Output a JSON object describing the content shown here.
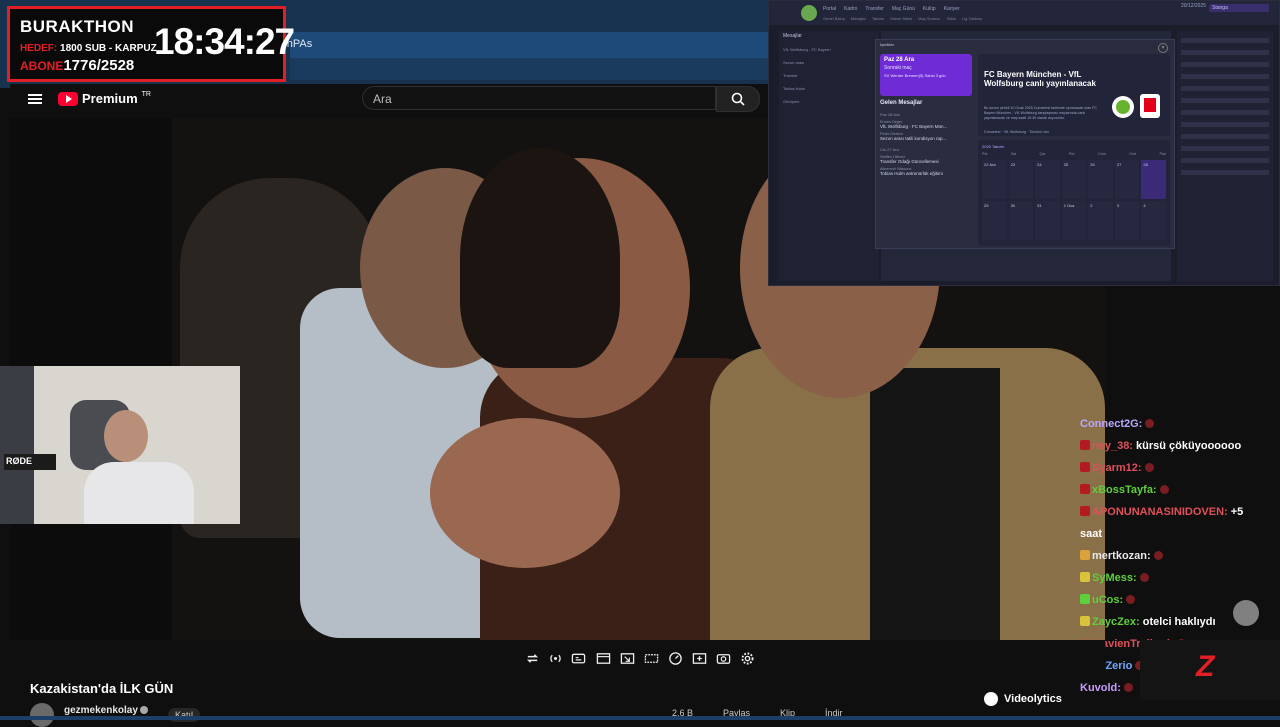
{
  "browser": {
    "tab_text": "FhPAs"
  },
  "counter": {
    "title": "BURAKTHON",
    "hedef_label": "HEDEF:",
    "hedef_value": "1800 SUB - KARPUZ",
    "abone_label": "ABONE",
    "abone_value": "1776/2528",
    "clock": "18:34:27"
  },
  "youtube": {
    "logo_text": "Premium",
    "logo_region": "TR",
    "search_placeholder": "Ara",
    "video_title": "Kazakistan'da İLK GÜN",
    "channel_name": "gezmekenkolay",
    "join_label": "Katıl",
    "actions": [
      "2,6 B",
      "Paylaş",
      "Klip",
      "İndir"
    ]
  },
  "webcam": {
    "mic_label": "RØDE"
  },
  "dashboard": {
    "nav": [
      "Portal",
      "Kadro",
      "Transfer",
      "Maç Günü",
      "Kulüp",
      "Kariyer"
    ],
    "subnav": [
      "Genel Bakış",
      "Mesajlar",
      "Takvim",
      "Haber Sitesi",
      "Maç Sonucu",
      "Tablo",
      "Lig Tablosu"
    ],
    "date_text": "20/12/2025",
    "lang_label": "Stanga",
    "left_panel_title": "Mesajlar",
    "left_rows": [
      "VfL Wolfsburg - FC Bayern",
      "Sezon arası",
      "Transfer",
      "Tobias Holm",
      "Görüşme"
    ],
    "modal_header": "İçerikler",
    "next_match": {
      "date": "Paz 28 Ara",
      "label": "Sonraki maç",
      "detail": "SV Werder Bremen(5) Sahsi 3 gün"
    },
    "messages_title": "Gelen Mesajlar",
    "message_groups": [
      {
        "section": "Paz 28 Ara",
        "items": [
          {
            "title": "VfL Wolfsburg - FC Bayern Mün...",
            "from": "Ermes Degre"
          },
          {
            "title": "Sezon arası tatili kondisyon rap...",
            "from": "Peter Dietrich"
          }
        ]
      },
      {
        "section": "Cts 27 Ara",
        "items": [
          {
            "title": "Transfer Odağı Güncellemesi",
            "from": "Steffen Hilbner"
          },
          {
            "title": "Tobias Holm antrenörlük eğitimi",
            "from": "Akberrcel Nilssons"
          }
        ]
      }
    ],
    "article": {
      "title": "FC Bayern München - VfL Wolfsburg canlı yayınlanacak",
      "body": "Bu sezon şehirli 10 Ocak 2025 Cumartesi tarihinde oynanacak olan FC Bayern München - VfL Wolfsburg karşılaşması maçlarında canlı yayınlanacak ve maç saati 15:30 olarak duyuruldu.",
      "meta": "Cumartesi · VfL Wolfsburg · Tümünü oku"
    },
    "calendar": {
      "header": "2025 Takvim",
      "days": [
        "Pzt",
        "Sal",
        "Çar",
        "Per",
        "Cum",
        "Cmt",
        "Paz"
      ],
      "cells": [
        "22 Ara",
        "23",
        "24",
        "25",
        "26",
        "27",
        "28",
        "29",
        "30",
        "31",
        "1 Oca",
        "2",
        "3",
        "4"
      ]
    }
  },
  "chat": [
    {
      "user": "Connect2G:",
      "message": "",
      "color": "#b9a9ff",
      "badge": ""
    },
    {
      "user": "ney_38:",
      "message": "kürsü çöküyoooooo",
      "color": "#e0505a",
      "badge": "#b31a22"
    },
    {
      "user": "Syarm12:",
      "message": "",
      "color": "#e0505a",
      "badge": "#b31a22"
    },
    {
      "user": "xBossTayfa:",
      "message": "",
      "color": "#5fcf3b",
      "badge": "#b31a22"
    },
    {
      "user": "APONUNANASINIDOVEN:",
      "message": "+5",
      "color": "#e0505a",
      "badge": "#b31a22"
    },
    {
      "user": "",
      "message": "saat",
      "color": "#ffffff",
      "badge": ""
    },
    {
      "user": "mertkozan:",
      "message": "",
      "color": "#e8e8e8",
      "badge": "#d9a23a"
    },
    {
      "user": "SyMess:",
      "message": "",
      "color": "#5fcf3b",
      "badge": "#d9c33a"
    },
    {
      "user": "uCos:",
      "message": "",
      "color": "#5fcf3b",
      "badge": "#5fcf3b"
    },
    {
      "user": "ZaycZex:",
      "message": "otelci haklıydı",
      "color": "#5fcf3b",
      "badge": "#d9c33a"
    },
    {
      "user": "SirSavienTrallard:",
      "message": "",
      "color": "#e0505a",
      "badge": ""
    },
    {
      "user": "MrZerio",
      "message": "",
      "color": "#6fa8ff",
      "badge": "#d9c33a"
    },
    {
      "user": "Kuvold:",
      "message": "",
      "color": "#c79bff",
      "badge": ""
    }
  ],
  "overlay": {
    "videolytics_label": "Videolytics",
    "brand_letter": "Z"
  },
  "icons": [
    "menu-icon",
    "search-icon",
    "loop-icon",
    "live-icon",
    "cc-icon",
    "chapters-icon",
    "miniplayer-icon",
    "theater-icon",
    "speed-icon",
    "add-icon",
    "screenshot-icon",
    "settings-icon"
  ]
}
